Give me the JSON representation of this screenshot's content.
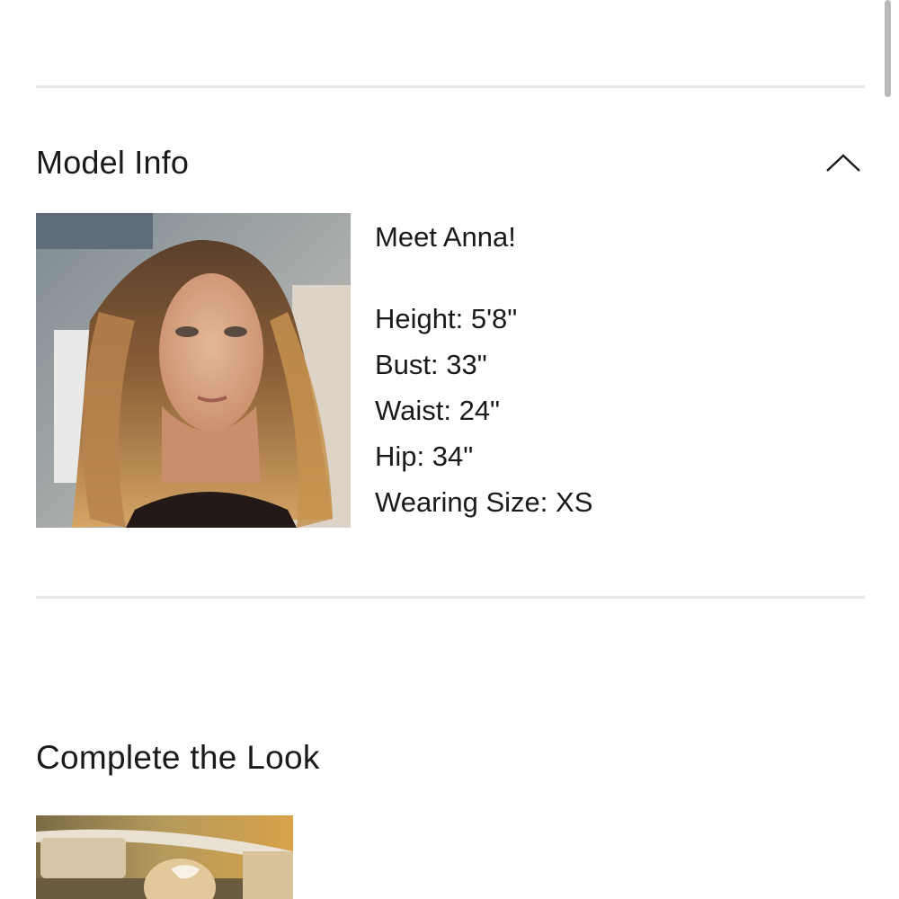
{
  "model_info": {
    "title": "Model Info",
    "toggle_icon": "chevron-up-icon",
    "intro": "Meet Anna!",
    "stats": [
      "Height: 5'8\"",
      "Bust: 33\"",
      "Waist: 24\"",
      "Hip: 34\"",
      "Wearing Size: XS"
    ]
  },
  "complete_the_look": {
    "title": "Complete the Look"
  },
  "colors": {
    "text": "#1a1a1a",
    "divider": "#e6e6e6",
    "scrollbar": "#b9b9b9"
  }
}
